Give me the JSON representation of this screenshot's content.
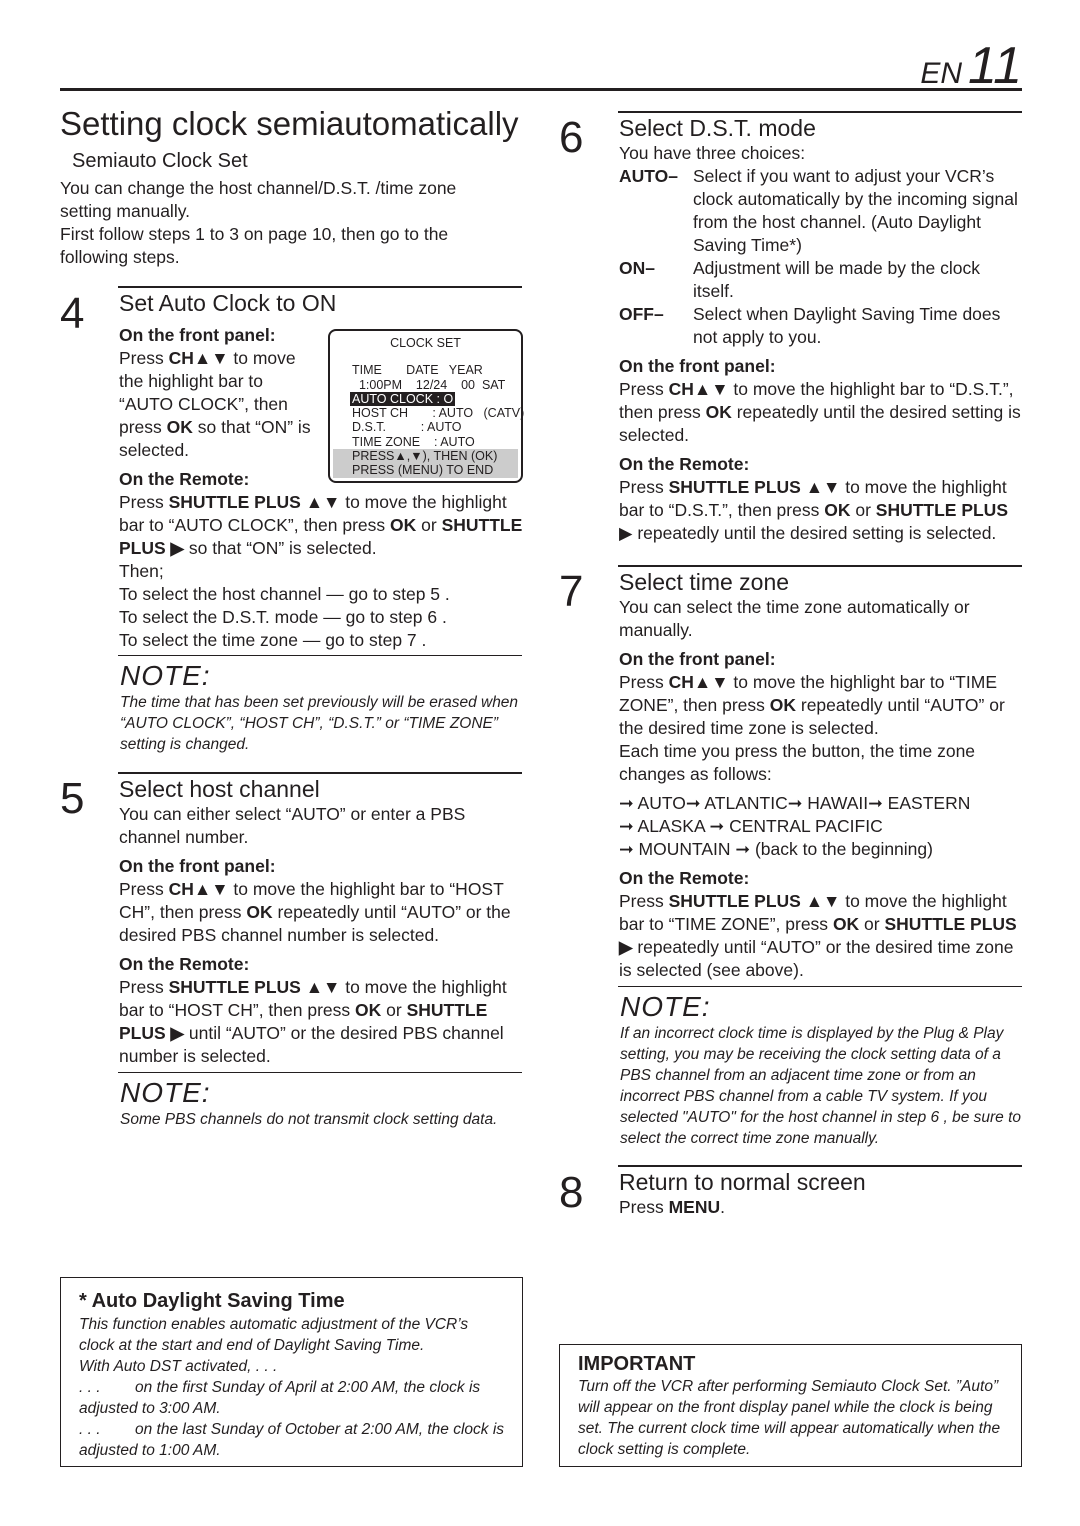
{
  "header": {
    "lang": "EN",
    "page": "11"
  },
  "title": "Setting clock semiautomatically",
  "subtitle": "Semiauto Clock Set",
  "intro": [
    [
      {
        "t": "You can change the host channel/D.S.T. /time zone setting manually."
      }
    ],
    [
      {
        "t": "First follow steps 1  to 3  on page 10, then go to the following steps."
      }
    ]
  ],
  "step4": {
    "num": "4",
    "heading": "Set Auto Clock to ON",
    "front_label": "On the front panel:",
    "front_text": [
      {
        "t": "Press "
      },
      {
        "t": "CH▲▼",
        "b": 1
      },
      {
        "t": " to move the highlight bar to “AUTO CLOCK”, then press "
      },
      {
        "t": "OK",
        "b": 1
      },
      {
        "t": " so that “ON” is selected."
      }
    ],
    "remote_label": "On the Remote:",
    "remote_text": [
      {
        "t": "Press "
      },
      {
        "t": "SHUTTLE PLUS ▲▼",
        "b": 1
      },
      {
        "t": " to move the highlight bar to “AUTO CLOCK”, then press "
      },
      {
        "t": "OK",
        "b": 1
      },
      {
        "t": " or "
      },
      {
        "t": "SHUTTLE PLUS ▶",
        "b": 1
      },
      {
        "t": " so that “ON” is selected."
      }
    ],
    "then": [
      "Then;",
      "To select the host channel — go to step 5 .",
      "To select the D.S.T. mode — go to step 6 .",
      "To select the time zone — go to step 7 ."
    ],
    "screen": {
      "title": "CLOCK SET",
      "row1": "TIME       DATE   YEAR",
      "row2": "  1:00PM    12/24    00  SAT",
      "highlight": "AUTO CLOCK : O",
      "row4": "HOST CH       : AUTO   (CATV)",
      "row5": "D.S.T.          : AUTO",
      "row6": "TIME ZONE    : AUTO",
      "row7": "PRESS▲,▼), THEN (OK)",
      "row8": "PRESS (MENU) TO END"
    }
  },
  "note1": {
    "heading": "NOTE:",
    "text": "The time that has been set previously will be erased when “AUTO CLOCK”, “HOST CH”, “D.S.T.” or “TIME ZONE” setting is changed."
  },
  "step5": {
    "num": "5",
    "heading": "Select host channel",
    "intro": [
      {
        "t": "You can either select “AUTO” or enter a PBS channel number."
      }
    ],
    "front_label": "On the front panel:",
    "front_text": [
      {
        "t": "Press "
      },
      {
        "t": "CH▲▼",
        "b": 1
      },
      {
        "t": " to move the highlight bar to “HOST CH”, then press "
      },
      {
        "t": "OK",
        "b": 1
      },
      {
        "t": " repeatedly until “AUTO” or the desired PBS channel number is selected."
      }
    ],
    "remote_label": "On the Remote:",
    "remote_text": [
      {
        "t": "Press "
      },
      {
        "t": "SHUTTLE PLUS ▲▼",
        "b": 1
      },
      {
        "t": " to move the highlight bar to “HOST CH”, then press "
      },
      {
        "t": "OK",
        "b": 1
      },
      {
        "t": " or "
      },
      {
        "t": "SHUTTLE PLUS ▶",
        "b": 1
      },
      {
        "t": " until “AUTO” or the desired PBS channel number is selected."
      }
    ]
  },
  "note2": {
    "heading": "NOTE:",
    "text": "Some PBS channels do not transmit clock setting data."
  },
  "dst_box": {
    "heading": "* Auto Daylight Saving Time",
    "lines": [
      "This function enables automatic adjustment of the VCR’s clock at the start and end of Daylight Saving Time.",
      "With Auto DST activated, . . .",
      ". . .        on the first Sunday of April at 2:00 AM, the clock is adjusted to 3:00 AM.",
      ". . .        on the last Sunday of October at 2:00 AM, the clock is adjusted to 1:00 AM."
    ]
  },
  "step6": {
    "num": "6",
    "heading": "Select D.S.T. mode",
    "intro": "You have three choices:",
    "choices": [
      {
        "k": "AUTO–",
        "v": "Select if you want to adjust your VCR’s clock automatically by the incoming signal from the host channel. (Auto Daylight Saving Time*)"
      },
      {
        "k": "ON–",
        "v": "Adjustment will be made by the clock itself."
      },
      {
        "k": "OFF–",
        "v": "Select when Daylight Saving Time does not apply to you."
      }
    ],
    "front_label": "On the front panel:",
    "front_text": [
      {
        "t": "Press "
      },
      {
        "t": "CH▲▼",
        "b": 1
      },
      {
        "t": " to move the highlight bar to “D.S.T.”, then press "
      },
      {
        "t": "OK",
        "b": 1
      },
      {
        "t": " repeatedly until the desired setting is selected."
      }
    ],
    "remote_label": "On the Remote:",
    "remote_text": [
      {
        "t": "Press "
      },
      {
        "t": "SHUTTLE PLUS ▲▼",
        "b": 1
      },
      {
        "t": " to move the highlight bar to “D.S.T.”, then press "
      },
      {
        "t": "OK",
        "b": 1
      },
      {
        "t": " or "
      },
      {
        "t": "SHUTTLE PLUS",
        "b": 1
      },
      {
        "t": " ▶ repeatedly until the desired setting is selected."
      }
    ]
  },
  "step7": {
    "num": "7",
    "heading": "Select time zone",
    "intro": [
      {
        "t": "You can select the time zone automatically or manually."
      }
    ],
    "front_label": "On the front panel:",
    "front_text": [
      {
        "t": "Press "
      },
      {
        "t": "CH▲▼",
        "b": 1
      },
      {
        "t": " to move the highlight bar to “TIME ZONE”, then press "
      },
      {
        "t": "OK",
        "b": 1
      },
      {
        "t": " repeatedly until “AUTO” or the desired time zone is selected."
      }
    ],
    "each": [
      {
        "t": "Each time you press the button, the time zone changes as follows:"
      }
    ],
    "sequence": [
      "➞ AUTO➞ ATLANTIC➞ HAWAII➞ EASTERN",
      "➞ ALASKA ➞ CENTRAL PACIFIC",
      "➞ MOUNTAIN ➞ (back to the beginning)"
    ],
    "remote_label": "On the Remote:",
    "remote_text": [
      {
        "t": "Press "
      },
      {
        "t": "SHUTTLE PLUS ▲▼",
        "b": 1
      },
      {
        "t": " to move the highlight bar to “TIME ZONE”, press "
      },
      {
        "t": "OK",
        "b": 1
      },
      {
        "t": " or "
      },
      {
        "t": "SHUTTLE PLUS ▶",
        "b": 1
      },
      {
        "t": " repeatedly until “AUTO” or the desired time zone is selected (see above)."
      }
    ]
  },
  "note3": {
    "heading": "NOTE:",
    "text": "If an incorrect clock time is displayed by the Plug & Play setting, you may be receiving the clock setting data of a PBS channel from an adjacent time zone or from an incorrect PBS channel from a cable TV system. If you selected \"AUTO\" for the host channel in step 6 , be sure to select the correct time zone manually."
  },
  "step8": {
    "num": "8",
    "heading": "Return to normal screen",
    "text": [
      {
        "t": "Press "
      },
      {
        "t": "MENU",
        "b": 1
      },
      {
        "t": "."
      }
    ]
  },
  "important": {
    "heading": "IMPORTANT",
    "text": "Turn off the VCR after performing Semiauto Clock Set. ”Auto” will appear on the front display panel while the clock is being set. The current clock time will appear automatically when the clock setting is complete."
  }
}
